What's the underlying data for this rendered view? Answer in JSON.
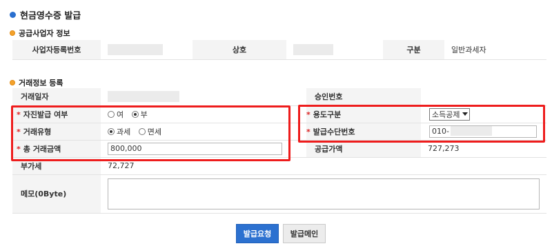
{
  "page": {
    "title": "현금영수증 발급"
  },
  "supplier": {
    "section_title": "공급사업자 정보",
    "biz_no_label": "사업자등록번호",
    "biz_no_value": "",
    "company_label": "상호",
    "company_value": "",
    "type_label": "구분",
    "type_value": "일반과세자"
  },
  "transaction": {
    "section_title": "거래정보 등록",
    "date_label": "거래일자",
    "date_value": "",
    "approval_label": "승인번호",
    "approval_value": "",
    "self_issue_label": "자진발급 여부",
    "self_issue_options": [
      "여",
      "부"
    ],
    "self_issue_selected": "부",
    "usage_label": "용도구분",
    "usage_selected": "소득공제",
    "tx_type_label": "거래유형",
    "tx_type_options": [
      "과세",
      "면세"
    ],
    "tx_type_selected": "과세",
    "issue_no_label": "발급수단번호",
    "issue_no_value": "010-",
    "total_label": "총 거래금액",
    "total_value": "800,000",
    "supply_label": "공급가액",
    "supply_value": "727,273",
    "vat_label": "부가세",
    "vat_value": "72,727",
    "memo_label": "메모(0Byte)",
    "memo_value": ""
  },
  "buttons": {
    "issue_request": "발급요청",
    "issue_main": "발급메인"
  },
  "colors": {
    "accent": "#2c71d0",
    "highlight": "#ee1c1c",
    "required": "#dd2222"
  }
}
